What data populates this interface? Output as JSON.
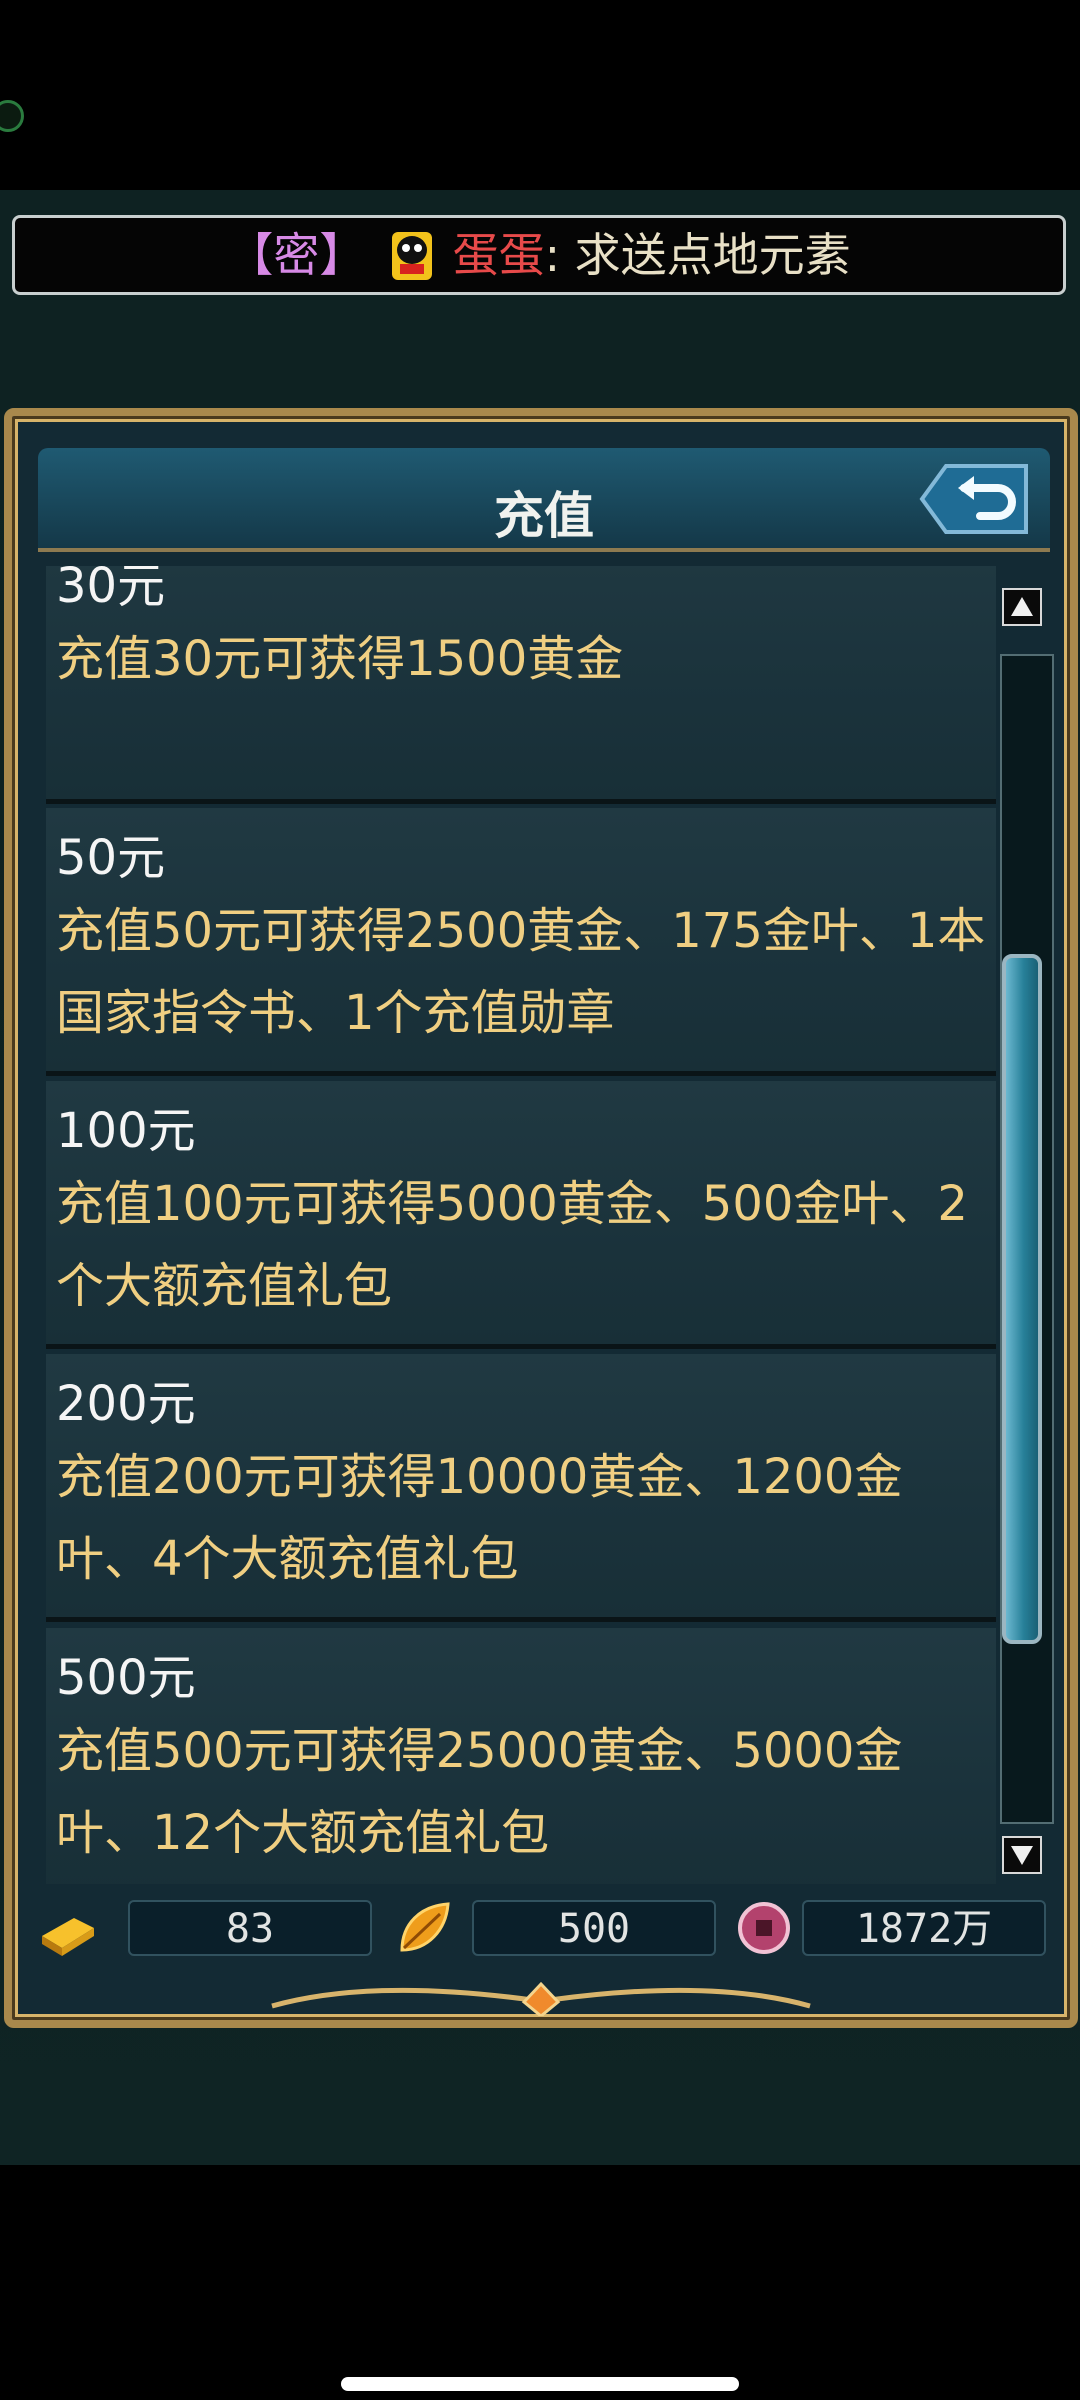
{
  "chat": {
    "channel": "【密】",
    "sender": "蛋蛋",
    "message": ": 求送点地元素"
  },
  "panel": {
    "title": "充值"
  },
  "recharge_items": [
    {
      "title": "30元",
      "desc": "充值30元可获得1500黄金"
    },
    {
      "title": "50元",
      "desc": "充值50元可获得2500黄金、175金叶、1本国家指令书、1个充值勋章"
    },
    {
      "title": "100元",
      "desc": "充值100元可获得5000黄金、500金叶、2个大额充值礼包"
    },
    {
      "title": "200元",
      "desc": "充值200元可获得10000黄金、1200金叶、4个大额充值礼包"
    },
    {
      "title": "500元",
      "desc": "充值500元可获得25000黄金、5000金叶、12个大额充值礼包"
    }
  ],
  "currencies": {
    "gold": "83",
    "leaf": "500",
    "coins": "1872万"
  },
  "colors": {
    "frame_gold": "#a9894c",
    "title_text": "#f0f2ee",
    "item_desc": "#f0cf82",
    "chat_channel": "#d78ae6",
    "chat_sender": "#e74a4a"
  },
  "icons": {
    "gold_icon": "gold-bar-icon",
    "leaf_icon": "golden-leaf-icon",
    "coin_icon": "coin-icon",
    "back_icon": "back-arrow-icon"
  }
}
